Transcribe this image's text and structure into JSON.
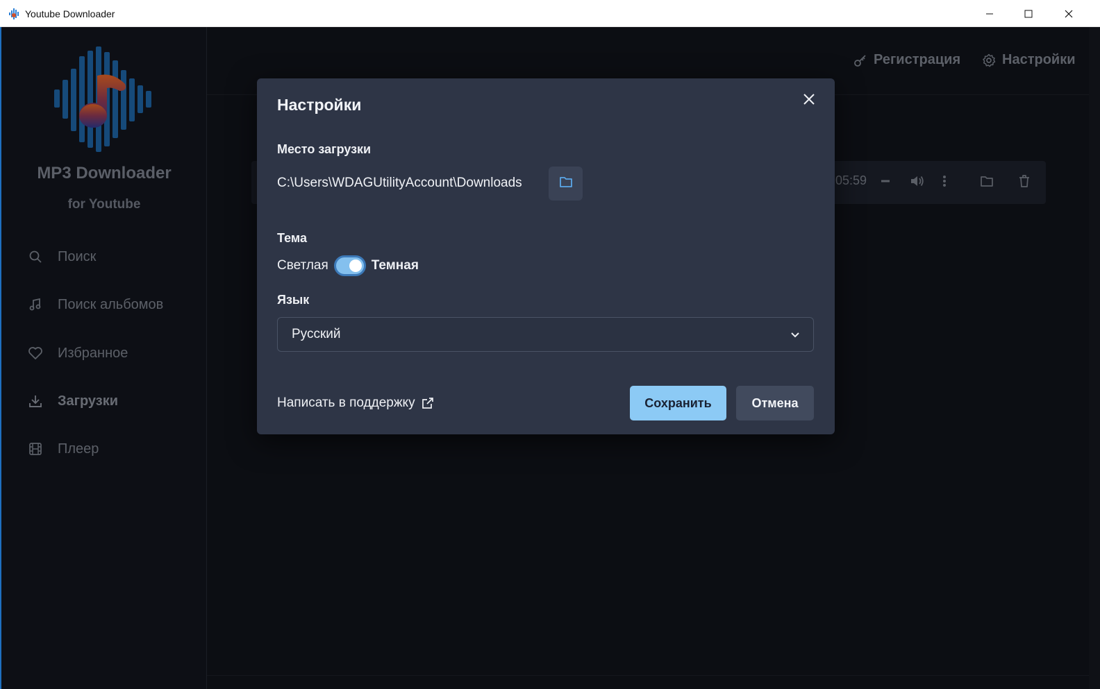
{
  "window": {
    "title": "Youtube Downloader",
    "controls": [
      "minimize",
      "maximize",
      "close"
    ]
  },
  "sidebar": {
    "brand_title": "MP3 Downloader",
    "brand_subtitle": "for Youtube",
    "items": [
      {
        "label": "Поиск",
        "icon": "search-icon",
        "active": false
      },
      {
        "label": "Поиск альбомов",
        "icon": "music-note-icon",
        "active": false
      },
      {
        "label": "Избранное",
        "icon": "heart-icon",
        "active": false
      },
      {
        "label": "Загрузки",
        "icon": "download-icon",
        "active": true
      },
      {
        "label": "Плеер",
        "icon": "film-icon",
        "active": false
      }
    ]
  },
  "header": {
    "register_label": "Регистрация",
    "settings_label": "Настройки"
  },
  "download_item": {
    "time": ":05:59"
  },
  "dialog": {
    "title": "Настройки",
    "location_label": "Место загрузки",
    "location_path": "C:\\Users\\WDAGUtilityAccount\\Downloads",
    "theme_label": "Тема",
    "theme_light": "Светлая",
    "theme_dark": "Темная",
    "theme_dark_enabled": true,
    "language_label": "Язык",
    "language_value": "Русский",
    "support_link": "Написать в поддержку",
    "save_label": "Сохранить",
    "cancel_label": "Отмена"
  },
  "colors": {
    "accent": "#8ccaf5",
    "dialog_bg": "#2e3546",
    "app_bg": "#0c0e13",
    "toggle_border": "#3c79b8"
  }
}
